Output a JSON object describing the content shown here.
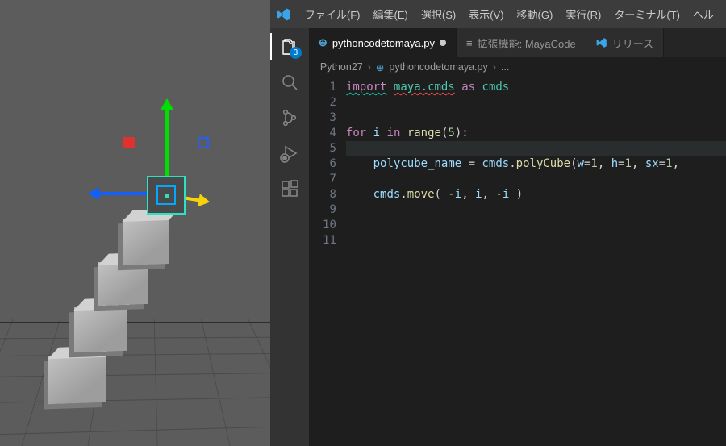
{
  "maya": {
    "selected_cube_index": 4
  },
  "vscode": {
    "menubar": [
      "ファイル(F)",
      "編集(E)",
      "選択(S)",
      "表示(V)",
      "移動(G)",
      "実行(R)",
      "ターミナル(T)",
      "ヘル"
    ],
    "activity_badge": "3",
    "tabs": {
      "active_file": "pythoncodetomaya.py",
      "extension_tab": "拡張機能: MayaCode",
      "release_tab": "リリース"
    },
    "breadcrumbs": {
      "folder": "Python27",
      "file": "pythoncodetomaya.py",
      "more": "..."
    },
    "code": {
      "line_count": 11,
      "l1_import": "import",
      "l1_module": "maya.cmds",
      "l1_as": "as",
      "l1_alias": "cmds",
      "l4_for": "for",
      "l4_var": "i",
      "l4_in": "in",
      "l4_range": "range",
      "l4_arg": "5",
      "l6_var": "polycube_name",
      "l6_eq": " = ",
      "l6_obj": "cmds",
      "l6_fn": "polyCube",
      "l6_kw_w": "w",
      "l6_kw_h": "h",
      "l6_kw_sx": "sx",
      "l6_v1": "1",
      "l8_obj": "cmds",
      "l8_fn": "move",
      "l8_a1": "-i",
      "l8_a2": "i",
      "l8_a3": "-i"
    }
  }
}
